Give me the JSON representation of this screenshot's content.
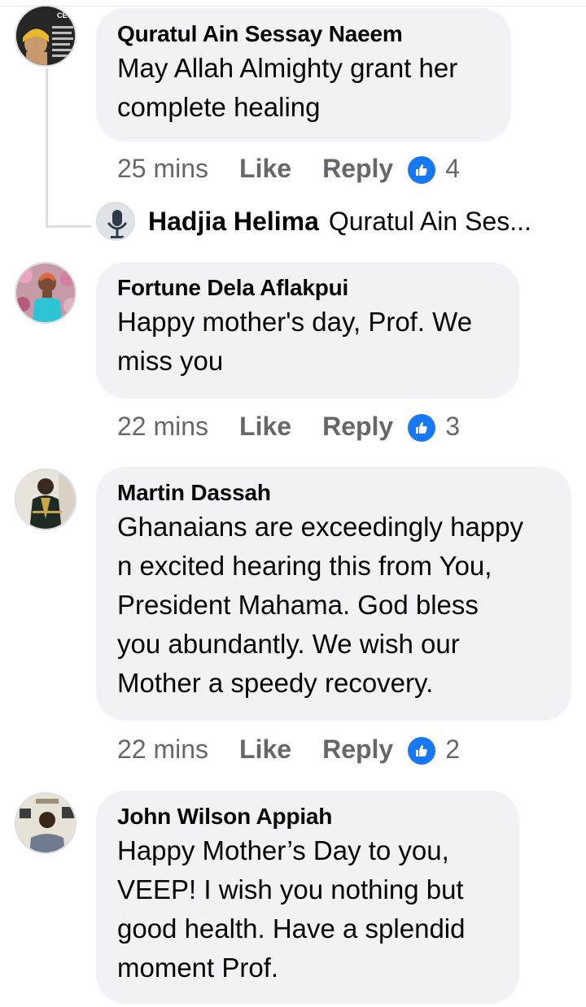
{
  "comments": [
    {
      "author": "Quratul Ain Sessay Naeem",
      "lines": [
        "May Allah Almighty grant her",
        "complete healing"
      ],
      "time": "25 mins",
      "like_label": "Like",
      "reply_label": "Reply",
      "likes": "4",
      "avatar_badge": "CEO"
    },
    {
      "author": "Fortune Dela Aflakpui",
      "lines": [
        "Happy mother's day, Prof. We",
        "miss you"
      ],
      "time": "22 mins",
      "like_label": "Like",
      "reply_label": "Reply",
      "likes": "3"
    },
    {
      "author": "Martin Dassah",
      "lines": [
        "Ghanaians are exceedingly happy",
        "n excited hearing this from You,",
        "President Mahama. God bless",
        "you abundantly. We wish our",
        "Mother a speedy recovery."
      ],
      "time": "22 mins",
      "like_label": "Like",
      "reply_label": "Reply",
      "likes": "2"
    },
    {
      "author": "John Wilson Appiah",
      "lines": [
        "Happy Mother’s Day to you,",
        "VEEP! I wish you nothing but",
        "good health.  Have a splendid",
        "moment Prof."
      ]
    }
  ],
  "reply": {
    "author": "Hadjia Helima",
    "preview": "Quratul Ain Ses..."
  },
  "colors": {
    "bubble": "#f0f2f5",
    "meta_text": "#65676b",
    "like_badge": "#1877f2",
    "thread_line": "#dadde1"
  }
}
